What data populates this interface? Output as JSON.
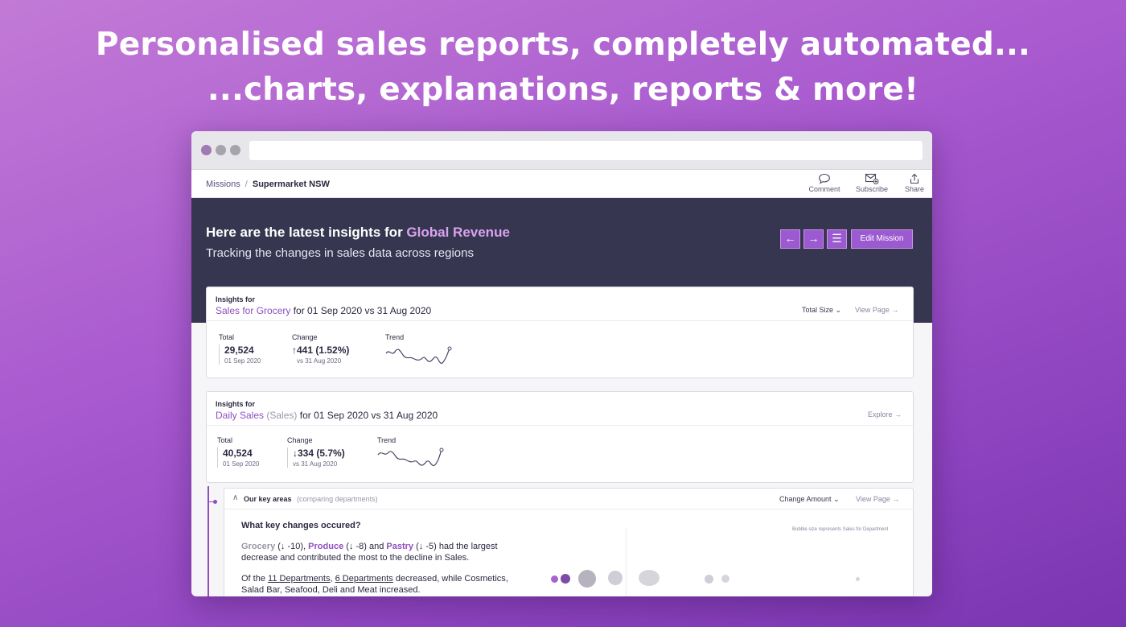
{
  "headline": {
    "line1": "Personalised sales reports, completely automated...",
    "line2": "...charts, explanations, reports & more!"
  },
  "breadcrumb": {
    "root": "Missions",
    "separator": "/",
    "current": "Supermarket NSW"
  },
  "toolbar": {
    "comment": "Comment",
    "subscribe": "Subscribe",
    "share": "Share"
  },
  "hero": {
    "title_prefix": "Here are the latest insights for",
    "title_accent": "Global Revenue",
    "subtitle": "Tracking the changes in sales data across regions",
    "prev_icon": "←",
    "next_icon": "→",
    "menu_icon": "☰",
    "edit_label": "Edit Mission"
  },
  "card1": {
    "label": "Insights for",
    "metric": "Sales for Grocery",
    "period": "for 01 Sep 2020 vs 31 Aug 2020",
    "dropdown": "Total Size",
    "link": "View Page",
    "total_label": "Total",
    "total_value": "29,524",
    "total_date": "01 Sep 2020",
    "change_label": "Change",
    "change_value": "↑441 (1.52%)",
    "change_date": "vs 31 Aug 2020",
    "trend_label": "Trend"
  },
  "card2": {
    "label": "Insights for",
    "metric": "Daily Sales",
    "metric_muted": "(Sales)",
    "period": "for 01 Sep 2020 vs 31 Aug 2020",
    "link": "Explore",
    "total_label": "Total",
    "total_value": "40,524",
    "total_date": "01 Sep 2020",
    "change_label": "Change",
    "change_value": "↓334 (5.7%)",
    "change_date": "vs 31 Aug 2020",
    "trend_label": "Trend"
  },
  "key_areas": {
    "chevron": "∧",
    "title": "Our key areas",
    "title_muted": "(comparing departments)",
    "dropdown": "Change Amount",
    "link": "View Page",
    "question": "What key changes occured?",
    "dept1": "Grocery",
    "dept1_change": "(↓ -10),",
    "dept2": "Produce",
    "dept2_change": "(↓ -8) and",
    "dept3": "Pastry",
    "dept3_change": "(↓ -5) had the largest decrease and contributed the most to the decline in Sales.",
    "p2_prefix": "Of the",
    "p2_link1": "11 Departments",
    "p2_link2": "6 Departments",
    "p2_rest": "decreased, while Cosmetics, Salad Bar, Seafood, Deli and Meat increased.",
    "bubble_note": "Bubble size represents Sales for Department"
  },
  "colors": {
    "accent": "#8f4fbf",
    "hero_bg": "#363650",
    "button": "#9c5ad0"
  }
}
